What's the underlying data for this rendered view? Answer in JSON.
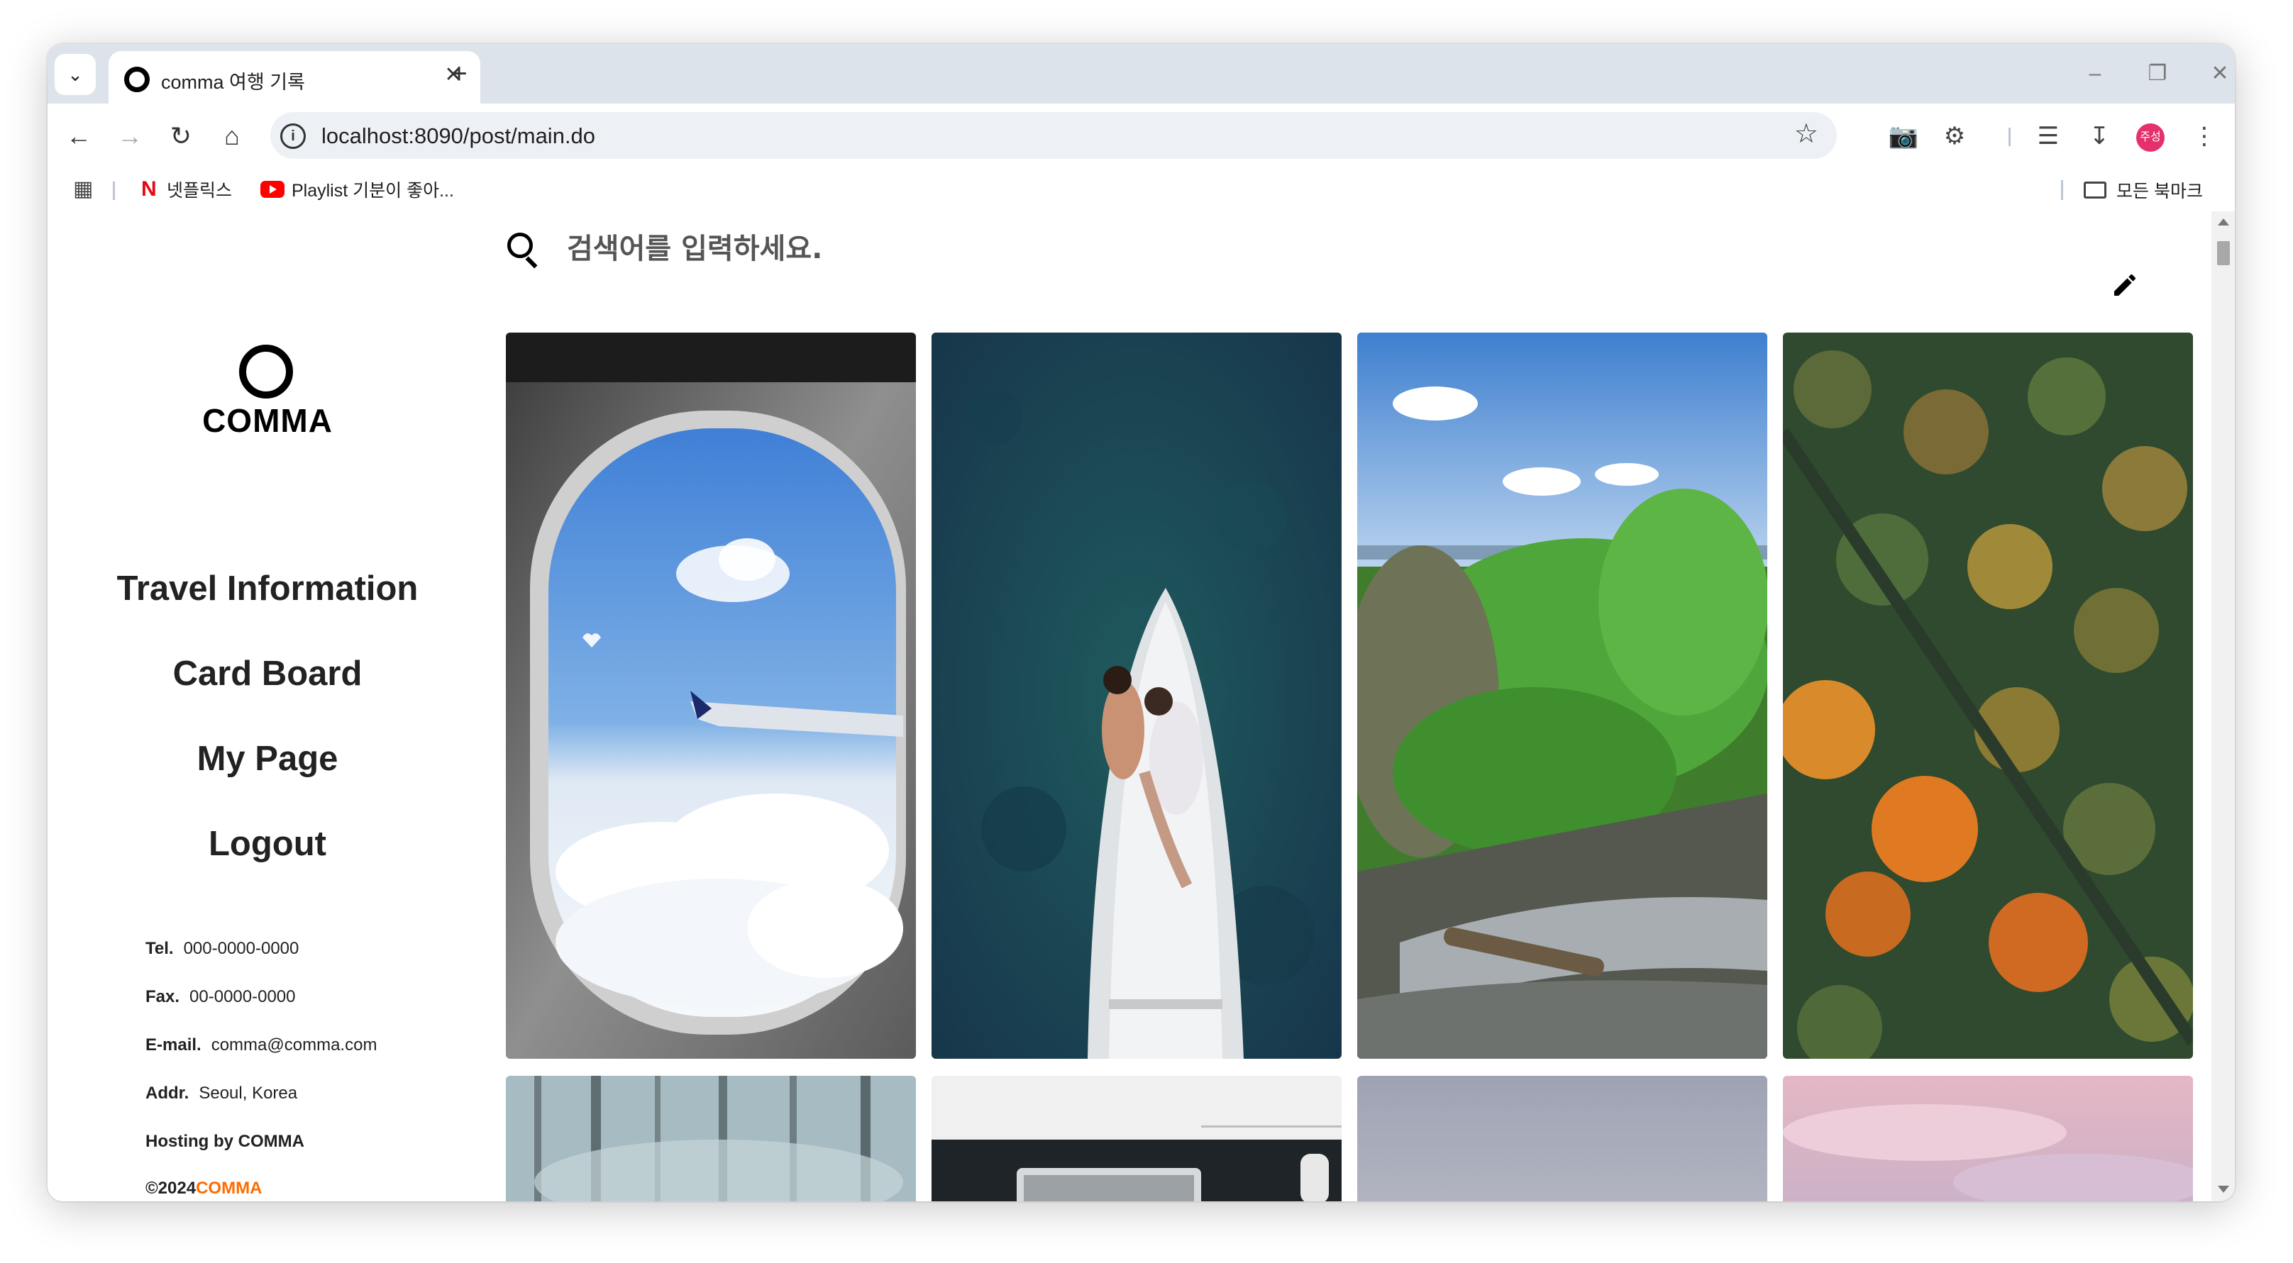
{
  "browser": {
    "tab_title": "comma 여행 기록",
    "url": "localhost:8090/post/main.do",
    "profile_badge": "주성",
    "bookmarks": [
      {
        "label": "넷플릭스",
        "icon": "netflix-icon"
      },
      {
        "label": "Playlist 기분이 좋아...",
        "icon": "youtube-icon"
      }
    ],
    "bookmarks_folder": "모든 북마크"
  },
  "sidebar": {
    "logo_text": "COMMA",
    "nav": [
      {
        "label": "Travel Information"
      },
      {
        "label": "Card Board"
      },
      {
        "label": "My Page"
      },
      {
        "label": "Logout"
      }
    ],
    "contact": [
      {
        "key": "Tel.",
        "value": "000-0000-0000"
      },
      {
        "key": "Fax.",
        "value": "00-0000-0000"
      },
      {
        "key": "E-mail.",
        "value": "comma@comma.com"
      },
      {
        "key": "Addr.",
        "value": "Seoul, Korea"
      },
      {
        "key": "Hosting by COMMA",
        "value": ""
      }
    ],
    "copyright_prefix": "©2024",
    "copyright_brand": "COMMA"
  },
  "search": {
    "placeholder": "검색어를 입력하세요."
  },
  "colors": {
    "brand_accent": "#ff6b00",
    "tab_strip": "#dde3ea",
    "omnibox": "#edf1f6"
  },
  "cards": [
    {
      "name": "airplane-window-photo"
    },
    {
      "name": "couple-on-boat-photo"
    },
    {
      "name": "forest-waterfall-photo"
    },
    {
      "name": "autumn-forest-aerial-photo"
    },
    {
      "name": "misty-forest-photo"
    },
    {
      "name": "keyboard-desk-photo"
    },
    {
      "name": "grey-sky-photo"
    },
    {
      "name": "pink-clouds-photo"
    }
  ]
}
